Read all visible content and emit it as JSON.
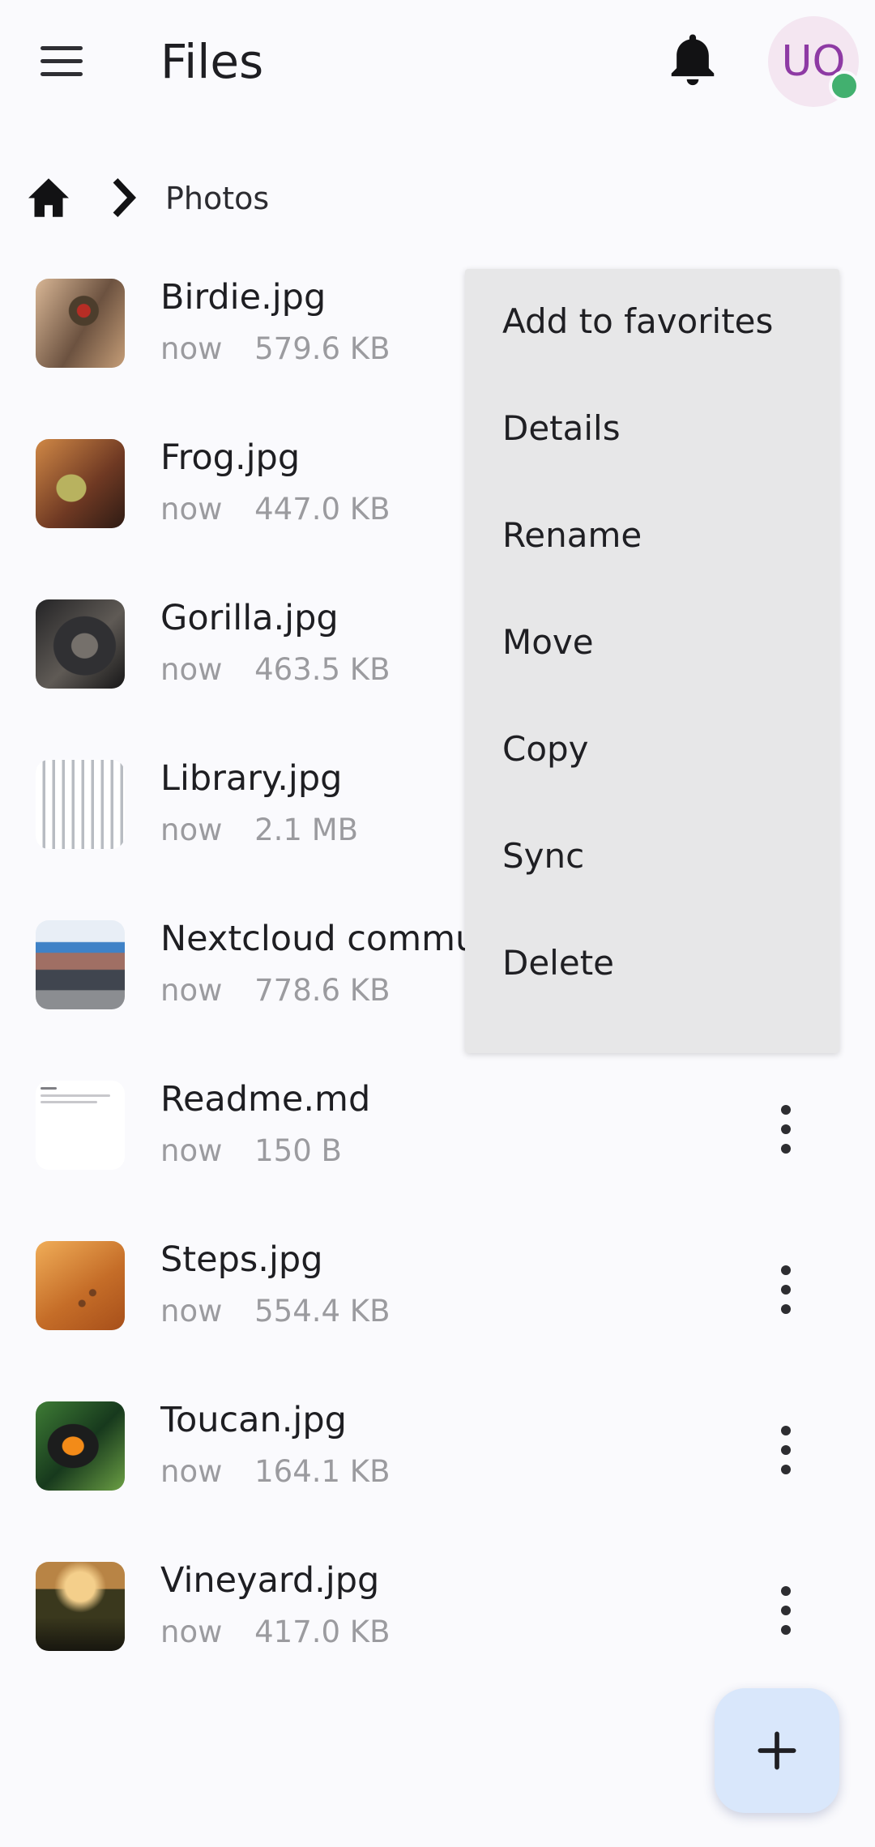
{
  "app": {
    "title": "Files",
    "avatar_initials": "UO",
    "status": "online"
  },
  "breadcrumb": {
    "current": "Photos"
  },
  "files": [
    {
      "name": "Birdie.jpg",
      "time": "now",
      "size": "579.6 KB",
      "thumb": "bird"
    },
    {
      "name": "Frog.jpg",
      "time": "now",
      "size": "447.0 KB",
      "thumb": "frog"
    },
    {
      "name": "Gorilla.jpg",
      "time": "now",
      "size": "463.5 KB",
      "thumb": "gorilla"
    },
    {
      "name": "Library.jpg",
      "time": "now",
      "size": "2.1 MB",
      "thumb": "library"
    },
    {
      "name": "Nextcloud commur",
      "time": "now",
      "size": "778.6 KB",
      "thumb": "community"
    },
    {
      "name": "Readme.md",
      "time": "now",
      "size": "150 B",
      "thumb": "document"
    },
    {
      "name": "Steps.jpg",
      "time": "now",
      "size": "554.4 KB",
      "thumb": "desert"
    },
    {
      "name": "Toucan.jpg",
      "time": "now",
      "size": "164.1 KB",
      "thumb": "toucan"
    },
    {
      "name": "Vineyard.jpg",
      "time": "now",
      "size": "417.0 KB",
      "thumb": "vineyard"
    }
  ],
  "context_menu": {
    "items": [
      "Add to favorites",
      "Details",
      "Rename",
      "Move",
      "Copy",
      "Sync",
      "Delete"
    ]
  },
  "icons": {
    "menu": "hamburger-menu-icon",
    "notifications": "bell-icon",
    "home": "home-icon",
    "separator": "chevron-right-icon",
    "more": "more-vertical-icon",
    "add": "plus-icon"
  },
  "colors": {
    "background": "#fafafd",
    "menu_background": "#e7e7e8",
    "fab_background": "#d9e7fb",
    "avatar_background": "#f4e6f1",
    "avatar_text": "#8e3aa4",
    "online_status": "#42b06f"
  }
}
